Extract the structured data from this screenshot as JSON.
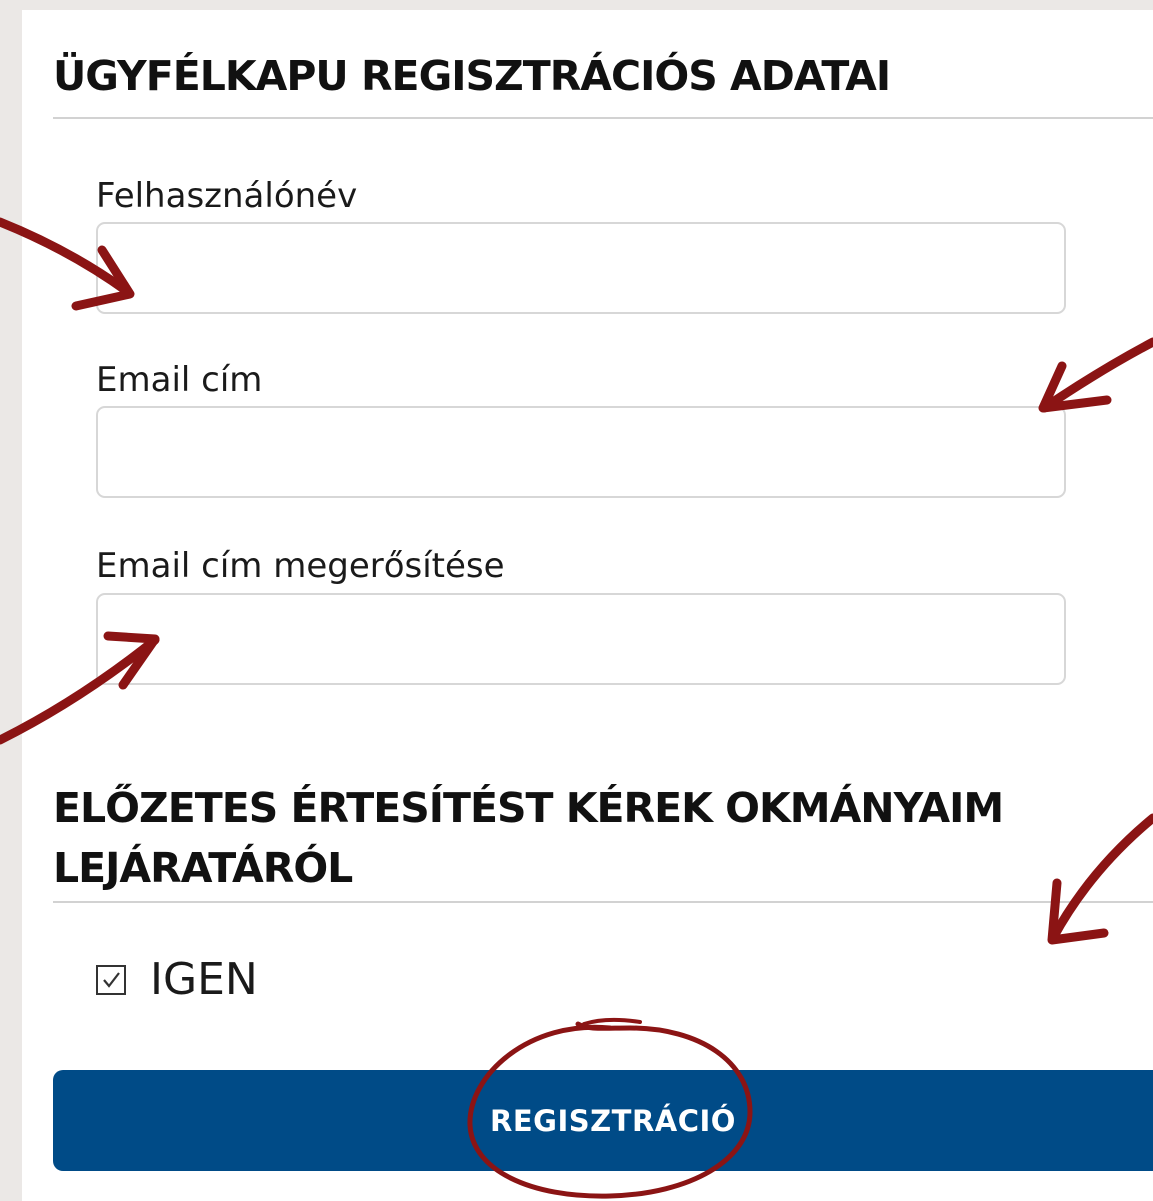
{
  "section1": {
    "title": "ÜGYFÉLKAPU REGISZTRÁCIÓS ADATAI"
  },
  "fields": {
    "username": {
      "label": "Felhasználónév",
      "value": "",
      "placeholder": ""
    },
    "email": {
      "label": "Email cím",
      "value": "",
      "placeholder": ""
    },
    "email_confirm": {
      "label": "Email cím megerősítése",
      "value": "",
      "placeholder": ""
    }
  },
  "section2": {
    "title_line1": "ELŐZETES ÉRTESÍTÉST KÉREK OKMÁNYAIM",
    "title_line2": "LEJÁRATÁRÓL"
  },
  "checkbox": {
    "label": "IGEN",
    "checked": true
  },
  "register_button": {
    "label": "REGISZTRÁCIÓ"
  },
  "colors": {
    "button_bg": "#004b87",
    "annotation": "#8b1414",
    "page_bg": "#ebe8e6"
  },
  "annotations": {
    "arrows": [
      "arrow-icon",
      "arrow-icon",
      "arrow-icon",
      "arrow-icon"
    ],
    "circle": "hand-drawn-circle-icon"
  }
}
